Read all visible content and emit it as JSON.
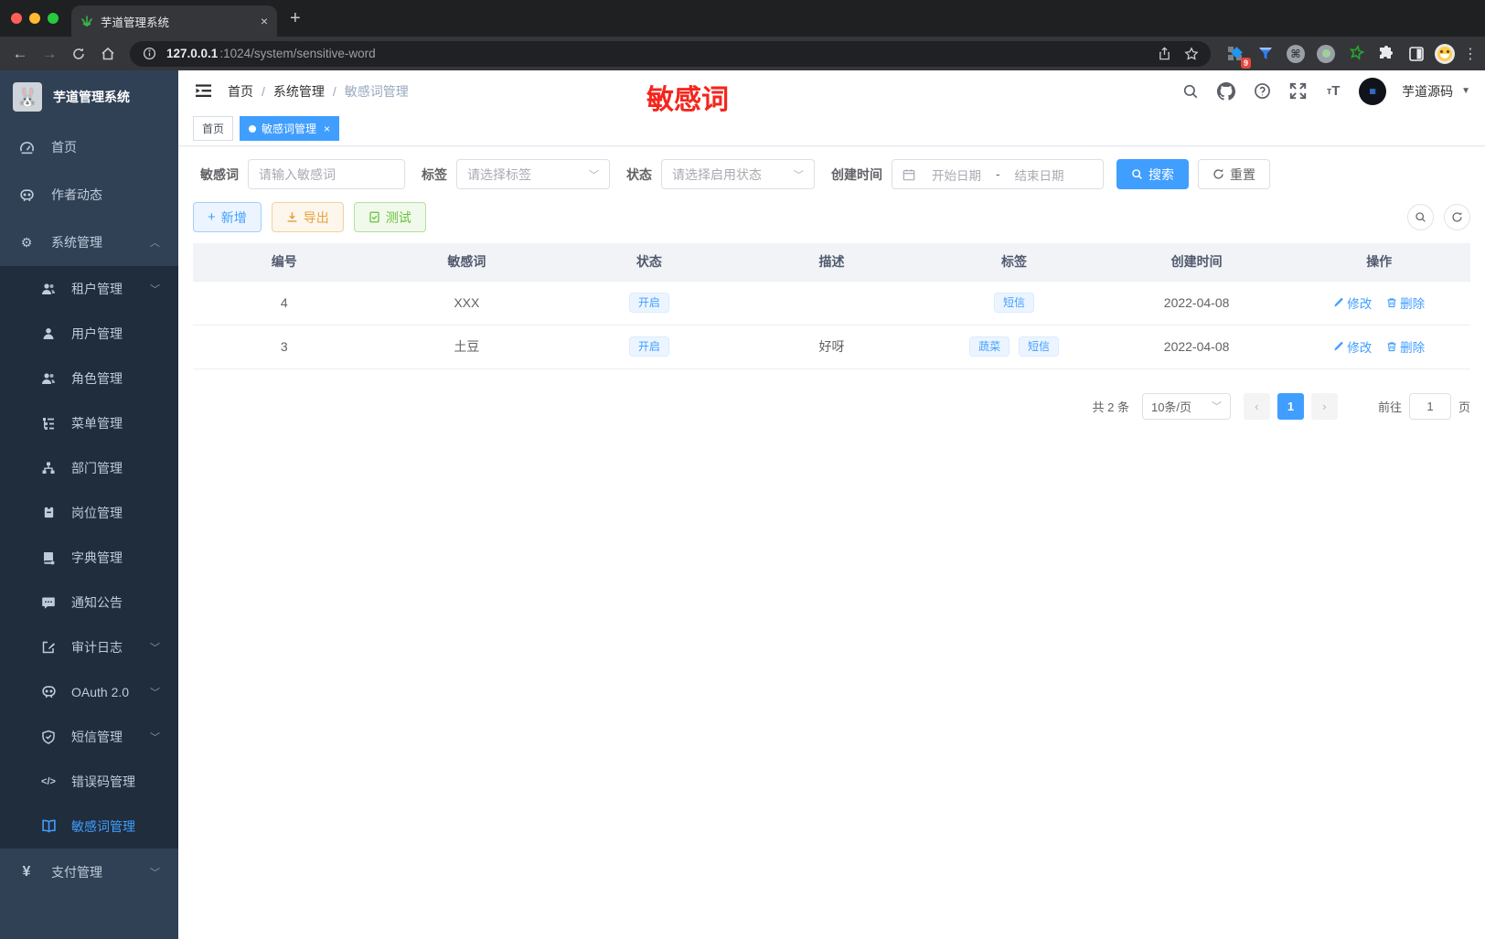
{
  "browser": {
    "tab_title": "芋道管理系统",
    "close_tab": "×",
    "url_host": "127.0.0.1",
    "url_rest": ":1024/system/sensitive-word",
    "extension_badge": "9"
  },
  "sidebar": {
    "app_title": "芋道管理系统",
    "items": [
      {
        "label": "首页"
      },
      {
        "label": "作者动态"
      },
      {
        "label": "系统管理"
      },
      {
        "label": "租户管理"
      },
      {
        "label": "用户管理"
      },
      {
        "label": "角色管理"
      },
      {
        "label": "菜单管理"
      },
      {
        "label": "部门管理"
      },
      {
        "label": "岗位管理"
      },
      {
        "label": "字典管理"
      },
      {
        "label": "通知公告"
      },
      {
        "label": "审计日志"
      },
      {
        "label": "OAuth 2.0"
      },
      {
        "label": "短信管理"
      },
      {
        "label": "错误码管理"
      },
      {
        "label": "敏感词管理"
      },
      {
        "label": "支付管理"
      }
    ]
  },
  "header": {
    "breadcrumb": {
      "home": "首页",
      "parent": "系统管理",
      "current": "敏感词管理"
    },
    "overlay_text": "敏感词",
    "username": "芋道源码"
  },
  "tags_view": {
    "home_tab": "首页",
    "active_tab": "敏感词管理"
  },
  "filters": {
    "word": {
      "label": "敏感词",
      "placeholder": "请输入敏感词"
    },
    "tag": {
      "label": "标签",
      "placeholder": "请选择标签"
    },
    "status": {
      "label": "状态",
      "placeholder": "请选择启用状态"
    },
    "create_time": {
      "label": "创建时间",
      "start_placeholder": "开始日期",
      "separator": "-",
      "end_placeholder": "结束日期"
    },
    "search_label": "搜索",
    "reset_label": "重置"
  },
  "toolbar": {
    "add_label": "新增",
    "export_label": "导出",
    "test_label": "测试"
  },
  "table": {
    "columns": [
      "编号",
      "敏感词",
      "状态",
      "描述",
      "标签",
      "创建时间",
      "操作"
    ],
    "edit_label": "修改",
    "delete_label": "删除",
    "rows": [
      {
        "id": "4",
        "word": "XXX",
        "status": "开启",
        "description": "",
        "tags": [
          "短信"
        ],
        "created": "2022-04-08"
      },
      {
        "id": "3",
        "word": "土豆",
        "status": "开启",
        "description": "好呀",
        "tags": [
          "蔬菜",
          "短信"
        ],
        "created": "2022-04-08"
      }
    ]
  },
  "pagination": {
    "total_label": "共 2 条",
    "page_size": "10条/页",
    "current_page": "1",
    "goto_label": "前往",
    "goto_value": "1",
    "page_suffix": "页"
  },
  "colors": {
    "accent_blue": "#409eff",
    "sidebar_bg": "#304156",
    "submenu_bg": "#1f2d3d",
    "overlay_red": "#f5251d"
  }
}
